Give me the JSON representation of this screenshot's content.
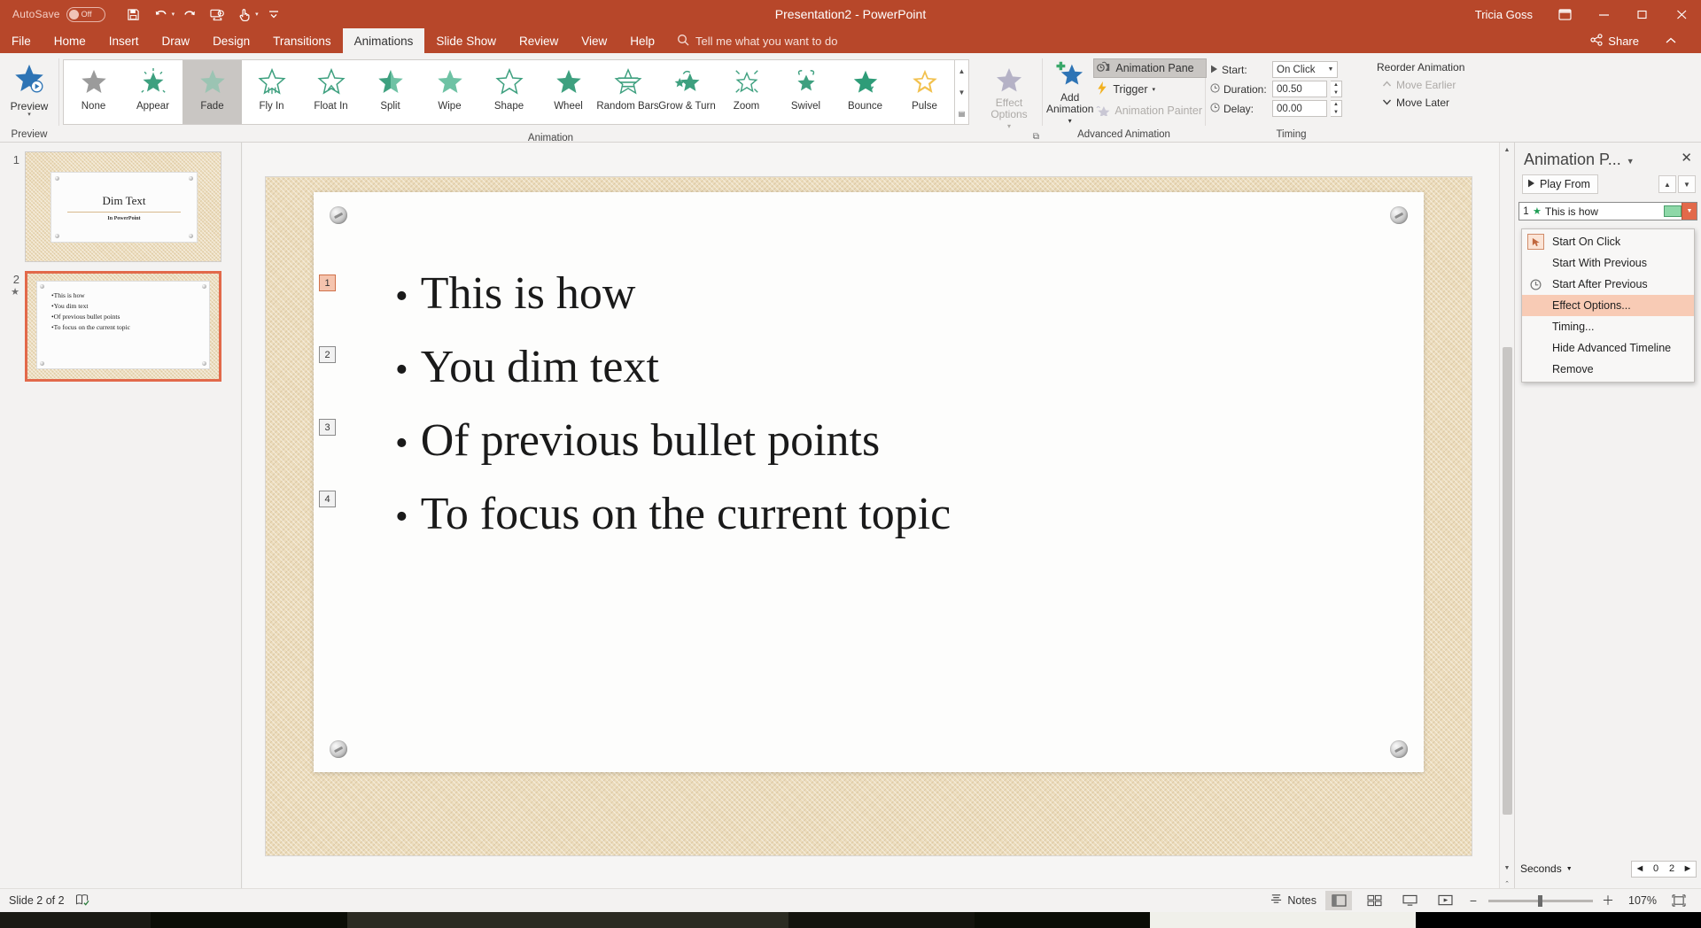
{
  "titlebar": {
    "autosave_label": "AutoSave",
    "autosave_state": "Off",
    "document_title": "Presentation2",
    "app_name": "PowerPoint",
    "title_full": "Presentation2  -  PowerPoint",
    "user_name": "Tricia Goss",
    "quick_access": [
      {
        "name": "save-icon",
        "label": "Save"
      },
      {
        "name": "undo-icon",
        "label": "Undo"
      },
      {
        "name": "redo-icon",
        "label": "Redo"
      },
      {
        "name": "start-from-beginning-icon",
        "label": "Start From Beginning"
      },
      {
        "name": "touch-mode-icon",
        "label": "Touch/Mouse Mode"
      },
      {
        "name": "customize-quick-access-toolbar-icon",
        "label": "Customize Quick Access Toolbar"
      }
    ],
    "window_buttons": [
      "ribbon-display-options",
      "minimize",
      "restore",
      "close"
    ]
  },
  "tabs": [
    {
      "label": "File",
      "active": false
    },
    {
      "label": "Home",
      "active": false
    },
    {
      "label": "Insert",
      "active": false
    },
    {
      "label": "Draw",
      "active": false
    },
    {
      "label": "Design",
      "active": false
    },
    {
      "label": "Transitions",
      "active": false
    },
    {
      "label": "Animations",
      "active": true
    },
    {
      "label": "Slide Show",
      "active": false
    },
    {
      "label": "Review",
      "active": false
    },
    {
      "label": "View",
      "active": false
    },
    {
      "label": "Help",
      "active": false
    }
  ],
  "tellme": {
    "placeholder": "Tell me what you want to do"
  },
  "share": {
    "label": "Share"
  },
  "ribbon": {
    "preview": {
      "group_label": "Preview",
      "button_label": "Preview"
    },
    "animation": {
      "group_label": "Animation",
      "items": [
        {
          "label": "None",
          "selected": false
        },
        {
          "label": "Appear",
          "selected": false
        },
        {
          "label": "Fade",
          "selected": true
        },
        {
          "label": "Fly In",
          "selected": false
        },
        {
          "label": "Float In",
          "selected": false
        },
        {
          "label": "Split",
          "selected": false
        },
        {
          "label": "Wipe",
          "selected": false
        },
        {
          "label": "Shape",
          "selected": false
        },
        {
          "label": "Wheel",
          "selected": false
        },
        {
          "label": "Random Bars",
          "selected": false
        },
        {
          "label": "Grow & Turn",
          "selected": false
        },
        {
          "label": "Zoom",
          "selected": false
        },
        {
          "label": "Swivel",
          "selected": false
        },
        {
          "label": "Bounce",
          "selected": false
        },
        {
          "label": "Pulse",
          "selected": false
        }
      ],
      "effect_options_label": "Effect Options",
      "effect_options_disabled": true
    },
    "advanced_animation": {
      "group_label": "Advanced Animation",
      "add_animation_label": "Add Animation",
      "animation_pane_label": "Animation Pane",
      "animation_pane_toggled": true,
      "trigger_label": "Trigger",
      "animation_painter_label": "Animation Painter",
      "animation_painter_disabled": true
    },
    "timing": {
      "group_label": "Timing",
      "start_label": "Start:",
      "start_value": "On Click",
      "duration_label": "Duration:",
      "duration_value": "00.50",
      "delay_label": "Delay:",
      "delay_value": "00.00"
    },
    "reorder": {
      "group_label": "Reorder Animation",
      "move_earlier_label": "Move Earlier",
      "move_earlier_disabled": true,
      "move_later_label": "Move Later",
      "move_later_disabled": false
    }
  },
  "thumbnails": [
    {
      "number": "1",
      "selected": false,
      "has_animation": false,
      "title": "Dim Text",
      "subtitle": "In PowerPoint",
      "type": "title"
    },
    {
      "number": "2",
      "selected": true,
      "has_animation": true,
      "type": "bullets",
      "bullets": [
        "This is how",
        "You dim text",
        "Of previous bullet points",
        "To focus on the current topic"
      ]
    }
  ],
  "slide": {
    "bullets": [
      {
        "tag": "1",
        "text": "This is how",
        "highlighted": true
      },
      {
        "tag": "2",
        "text": "You dim text",
        "highlighted": false
      },
      {
        "tag": "3",
        "text": "Of previous bullet points",
        "highlighted": false
      },
      {
        "tag": "4",
        "text": "To focus on the current topic",
        "highlighted": false
      }
    ]
  },
  "animation_pane": {
    "title": "Animation P...",
    "close_label": "Close",
    "play_from_label": "Play From",
    "move_up_label": "Move Up",
    "move_down_label": "Move Down",
    "items": [
      {
        "index": "1",
        "name": "This is how",
        "selected": true
      }
    ],
    "seconds_label": "Seconds",
    "ruler_marks": [
      "0",
      "2"
    ]
  },
  "context_menu": {
    "items": [
      {
        "label": "Start On Click",
        "accel": "",
        "highlighted": false,
        "icon": "start-on-click-icon",
        "boxed": true
      },
      {
        "label": "Start With Previous",
        "accel": "W",
        "highlighted": false,
        "icon": "",
        "boxed": false
      },
      {
        "label": "Start After Previous",
        "accel": "A",
        "highlighted": false,
        "icon": "start-after-previous-icon",
        "boxed": false
      },
      {
        "label": "Effect Options...",
        "accel": "E",
        "highlighted": true,
        "icon": "",
        "boxed": false
      },
      {
        "label": "Timing...",
        "accel": "T",
        "highlighted": false,
        "icon": "",
        "boxed": false
      },
      {
        "label": "Hide Advanced Timeline",
        "accel": "",
        "highlighted": false,
        "icon": "",
        "boxed": false
      },
      {
        "label": "Remove",
        "accel": "R",
        "highlighted": false,
        "icon": "",
        "boxed": false
      }
    ]
  },
  "statusbar": {
    "slide_indicator": "Slide 2 of 2",
    "accessibility_label": "Accessibility Checker",
    "notes_label": "Notes",
    "zoom_percent": "107%",
    "zoom_out_label": "Zoom Out",
    "zoom_in_label": "Zoom In",
    "fit_slide_label": "Fit slide to current window",
    "views": [
      "Normal",
      "Slide Sorter",
      "Reading View",
      "Slide Show"
    ]
  }
}
